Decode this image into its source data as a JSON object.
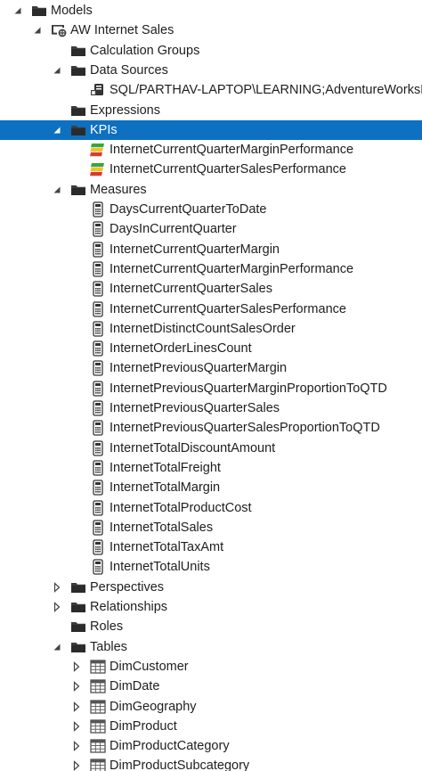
{
  "tree": [
    {
      "label": "Models",
      "depth": 0,
      "icon": "folder-icon",
      "expander": "expanded"
    },
    {
      "label": "AW Internet Sales",
      "depth": 1,
      "icon": "model-icon",
      "expander": "expanded"
    },
    {
      "label": "Calculation Groups",
      "depth": 2,
      "icon": "folder-icon",
      "expander": "none"
    },
    {
      "label": "Data Sources",
      "depth": 2,
      "icon": "folder-icon",
      "expander": "expanded"
    },
    {
      "label": "SQL/PARTHAV-LAPTOP\\LEARNING;AdventureWorksDW",
      "depth": 3,
      "icon": "datasource-icon",
      "expander": "none"
    },
    {
      "label": "Expressions",
      "depth": 2,
      "icon": "folder-icon",
      "expander": "none"
    },
    {
      "label": "KPIs",
      "depth": 2,
      "icon": "folder-icon",
      "expander": "expanded",
      "selected": true
    },
    {
      "label": "InternetCurrentQuarterMarginPerformance",
      "depth": 3,
      "icon": "kpi-icon",
      "expander": "none"
    },
    {
      "label": "InternetCurrentQuarterSalesPerformance",
      "depth": 3,
      "icon": "kpi-icon",
      "expander": "none"
    },
    {
      "label": "Measures",
      "depth": 2,
      "icon": "folder-icon",
      "expander": "expanded"
    },
    {
      "label": "DaysCurrentQuarterToDate",
      "depth": 3,
      "icon": "measure-icon",
      "expander": "none"
    },
    {
      "label": "DaysInCurrentQuarter",
      "depth": 3,
      "icon": "measure-icon",
      "expander": "none"
    },
    {
      "label": "InternetCurrentQuarterMargin",
      "depth": 3,
      "icon": "measure-icon",
      "expander": "none"
    },
    {
      "label": "InternetCurrentQuarterMarginPerformance",
      "depth": 3,
      "icon": "measure-icon",
      "expander": "none"
    },
    {
      "label": "InternetCurrentQuarterSales",
      "depth": 3,
      "icon": "measure-icon",
      "expander": "none"
    },
    {
      "label": "InternetCurrentQuarterSalesPerformance",
      "depth": 3,
      "icon": "measure-icon",
      "expander": "none"
    },
    {
      "label": "InternetDistinctCountSalesOrder",
      "depth": 3,
      "icon": "measure-icon",
      "expander": "none"
    },
    {
      "label": "InternetOrderLinesCount",
      "depth": 3,
      "icon": "measure-icon",
      "expander": "none"
    },
    {
      "label": "InternetPreviousQuarterMargin",
      "depth": 3,
      "icon": "measure-icon",
      "expander": "none"
    },
    {
      "label": "InternetPreviousQuarterMarginProportionToQTD",
      "depth": 3,
      "icon": "measure-icon",
      "expander": "none"
    },
    {
      "label": "InternetPreviousQuarterSales",
      "depth": 3,
      "icon": "measure-icon",
      "expander": "none"
    },
    {
      "label": "InternetPreviousQuarterSalesProportionToQTD",
      "depth": 3,
      "icon": "measure-icon",
      "expander": "none"
    },
    {
      "label": "InternetTotalDiscountAmount",
      "depth": 3,
      "icon": "measure-icon",
      "expander": "none"
    },
    {
      "label": "InternetTotalFreight",
      "depth": 3,
      "icon": "measure-icon",
      "expander": "none"
    },
    {
      "label": "InternetTotalMargin",
      "depth": 3,
      "icon": "measure-icon",
      "expander": "none"
    },
    {
      "label": "InternetTotalProductCost",
      "depth": 3,
      "icon": "measure-icon",
      "expander": "none"
    },
    {
      "label": "InternetTotalSales",
      "depth": 3,
      "icon": "measure-icon",
      "expander": "none"
    },
    {
      "label": "InternetTotalTaxAmt",
      "depth": 3,
      "icon": "measure-icon",
      "expander": "none"
    },
    {
      "label": "InternetTotalUnits",
      "depth": 3,
      "icon": "measure-icon",
      "expander": "none"
    },
    {
      "label": "Perspectives",
      "depth": 2,
      "icon": "folder-icon",
      "expander": "collapsed"
    },
    {
      "label": "Relationships",
      "depth": 2,
      "icon": "folder-icon",
      "expander": "collapsed"
    },
    {
      "label": "Roles",
      "depth": 2,
      "icon": "folder-icon",
      "expander": "none"
    },
    {
      "label": "Tables",
      "depth": 2,
      "icon": "folder-icon",
      "expander": "expanded"
    },
    {
      "label": "DimCustomer",
      "depth": 3,
      "icon": "table-icon",
      "expander": "collapsed"
    },
    {
      "label": "DimDate",
      "depth": 3,
      "icon": "table-icon",
      "expander": "collapsed"
    },
    {
      "label": "DimGeography",
      "depth": 3,
      "icon": "table-icon",
      "expander": "collapsed"
    },
    {
      "label": "DimProduct",
      "depth": 3,
      "icon": "table-icon",
      "expander": "collapsed"
    },
    {
      "label": "DimProductCategory",
      "depth": 3,
      "icon": "table-icon",
      "expander": "collapsed"
    },
    {
      "label": "DimProductSubcategory",
      "depth": 3,
      "icon": "table-icon",
      "expander": "collapsed"
    }
  ],
  "colors": {
    "selection_bg": "#0e70c0",
    "selection_text": "#ffffff",
    "text": "#1e1e1e",
    "folder": "#3c3c3c",
    "kpi_green": "#3da639",
    "kpi_yellow": "#f2c12e",
    "kpi_red": "#d83b2b"
  }
}
